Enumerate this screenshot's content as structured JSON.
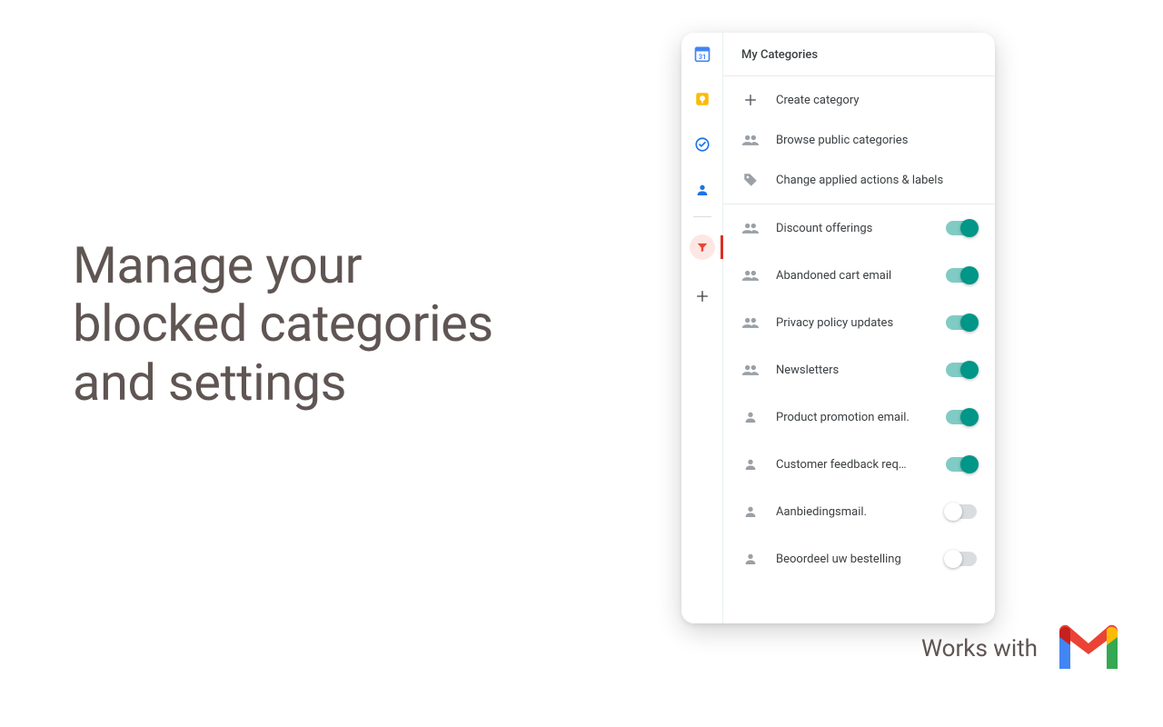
{
  "headline": "Manage your\nblocked categories\nand settings",
  "panel": {
    "title": "My Categories",
    "actions": {
      "create": "Create category",
      "browse": "Browse public categories",
      "change": "Change applied actions & labels"
    },
    "categories": [
      {
        "label": "Discount offerings",
        "enabled": true,
        "icon": "group"
      },
      {
        "label": "Abandoned cart email",
        "enabled": true,
        "icon": "group"
      },
      {
        "label": "Privacy policy updates",
        "enabled": true,
        "icon": "group"
      },
      {
        "label": "Newsletters",
        "enabled": true,
        "icon": "group"
      },
      {
        "label": "Product promotion email.",
        "enabled": true,
        "icon": "person"
      },
      {
        "label": "Customer feedback req…",
        "enabled": true,
        "icon": "person"
      },
      {
        "label": "Aanbiedingsmail.",
        "enabled": false,
        "icon": "person"
      },
      {
        "label": "Beoordeel uw bestelling",
        "enabled": false,
        "icon": "person"
      }
    ]
  },
  "footer": {
    "works_with": "Works with"
  }
}
